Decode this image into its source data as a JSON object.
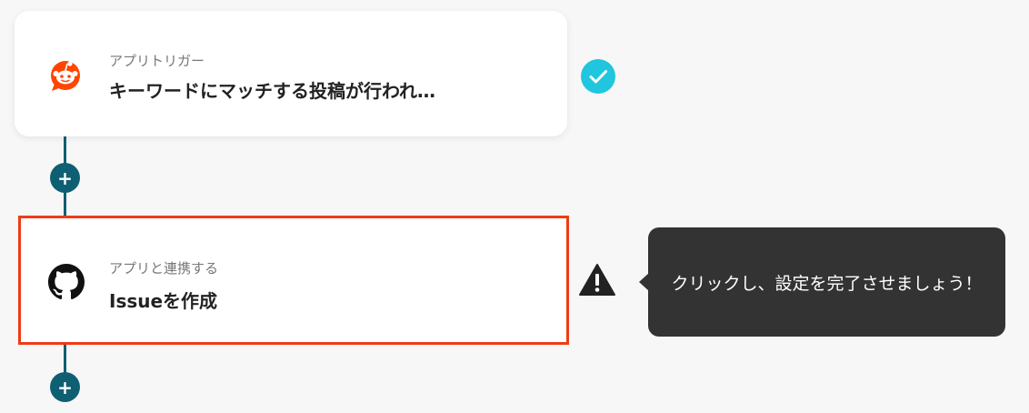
{
  "flow": {
    "steps": [
      {
        "app_icon": "reddit-icon",
        "subtitle": "アプリトリガー",
        "title": "キーワードにマッチする投稿が行われ…",
        "status_icon": "check-icon"
      },
      {
        "app_icon": "github-icon",
        "subtitle": "アプリと連携する",
        "title": "Issueを作成",
        "status_icon": "warning-icon"
      }
    ],
    "add_button_label": "+"
  },
  "tooltip": {
    "text": "クリックし、設定を完了させましょう！"
  },
  "colors": {
    "background": "#f7f7f7",
    "connector": "#0f5f73",
    "check_badge": "#1fc6dd",
    "selected_border": "#f03b16",
    "reddit_orange": "#ff4500",
    "tooltip_bg": "#333333",
    "warning": "#222222"
  }
}
